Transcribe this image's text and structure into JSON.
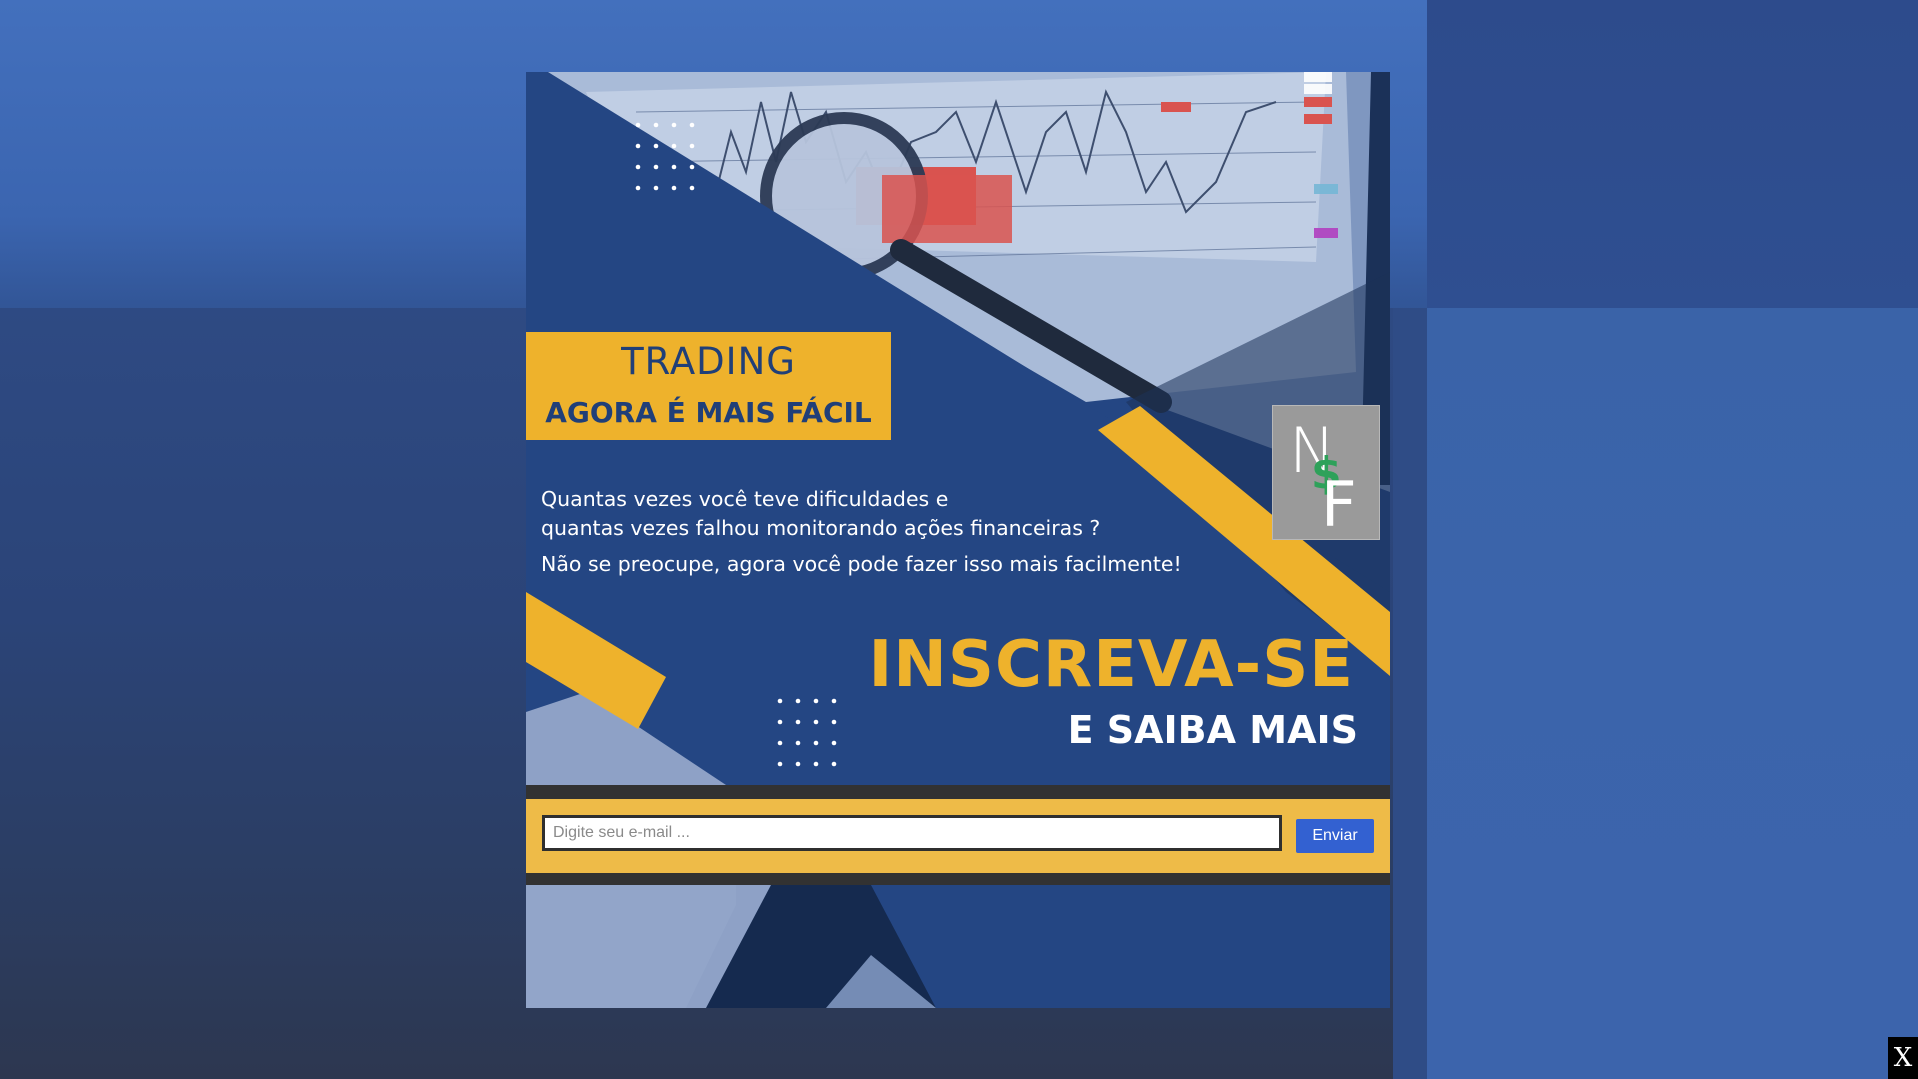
{
  "banner": {
    "tag_title": "TRADING",
    "tag_subtitle": "AGORA É MAIS FÁCIL",
    "copy_line_1": "Quantas vezes você teve dificuldades e",
    "copy_line_2": "quantas vezes falhou monitorando ações financeiras ?",
    "copy_line_3": "Não se preocupe, agora você pode fazer isso mais facilmente!",
    "cta_title": "INSCREVA-SE",
    "cta_subtitle": "E SAIBA MAIS",
    "logo": {
      "letter_top": "N",
      "symbol": "$",
      "letter_bottom": "F"
    }
  },
  "form": {
    "email_placeholder": "Digite seu e-mail ...",
    "email_value": "",
    "submit_label": "Enviar"
  },
  "close_label": "X",
  "colors": {
    "banner_blue": "#244683",
    "accent_yellow": "#eeb22c",
    "form_bg": "#eebb48",
    "button_blue": "#3361d1",
    "logo_green": "#2ea15a"
  }
}
